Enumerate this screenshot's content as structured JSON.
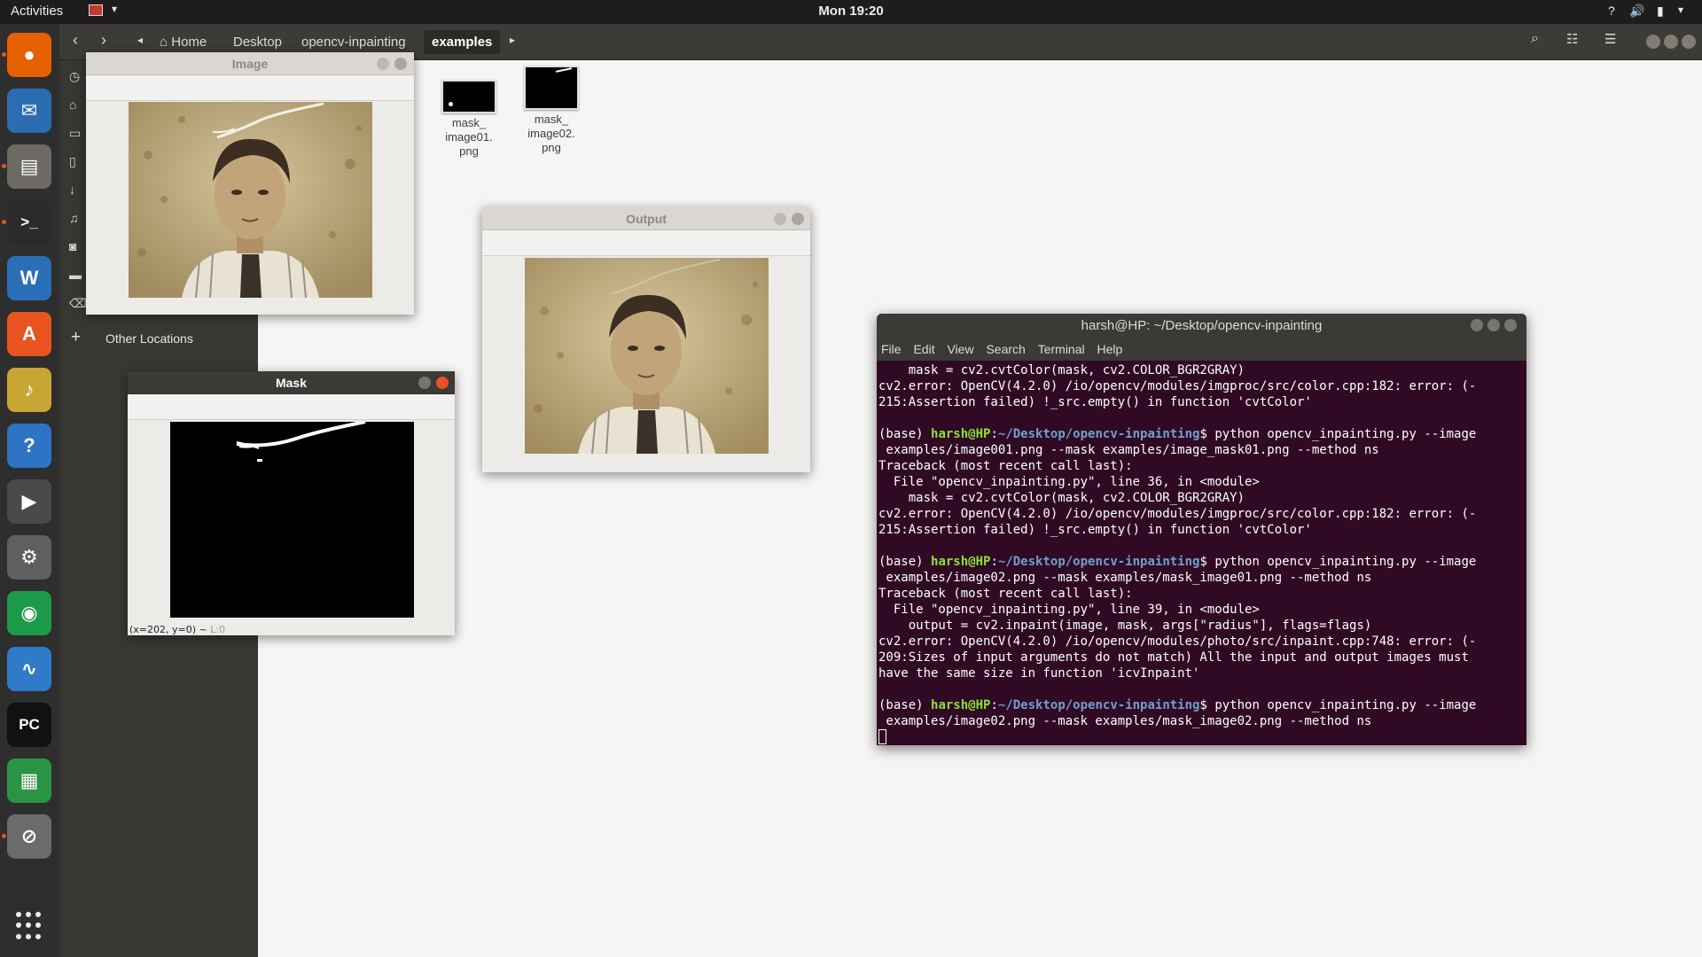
{
  "topbar": {
    "activities": "Activities",
    "clock": "Mon 19:20",
    "tray": {
      "help": "?",
      "volume": "🔊",
      "battery": "▮"
    }
  },
  "dock": {
    "items": [
      {
        "name": "firefox",
        "glyph": "●",
        "color": "#e66000",
        "running": true
      },
      {
        "name": "thunderbird",
        "glyph": "✉",
        "color": "#2b6cb0",
        "running": false
      },
      {
        "name": "files",
        "glyph": "▤",
        "color": "#6d6a63",
        "running": true
      },
      {
        "name": "terminal",
        "glyph": ">_",
        "color": "#2b2b2b",
        "running": true
      },
      {
        "name": "writer",
        "glyph": "W",
        "color": "#2a6fb8",
        "running": false
      },
      {
        "name": "software",
        "glyph": "A",
        "color": "#e95420",
        "running": false
      },
      {
        "name": "rhythmbox",
        "glyph": "♪",
        "color": "#c8a633",
        "running": false
      },
      {
        "name": "help",
        "glyph": "?",
        "color": "#2e74c4",
        "running": false
      },
      {
        "name": "videos",
        "glyph": "▶",
        "color": "#4a4a4a",
        "running": false
      },
      {
        "name": "settings",
        "glyph": "⚙",
        "color": "#5f5f5f",
        "running": false
      },
      {
        "name": "chrome",
        "glyph": "◉",
        "color": "#1b9a48",
        "running": false
      },
      {
        "name": "monitor",
        "glyph": "∿",
        "color": "#2f7ac9",
        "running": false
      },
      {
        "name": "pycharm",
        "glyph": "PC",
        "color": "#111111",
        "running": false
      },
      {
        "name": "calc",
        "glyph": "▦",
        "color": "#2b9444",
        "running": false
      },
      {
        "name": "blocked",
        "glyph": "⊘",
        "color": "#6b6b6b",
        "running": true
      }
    ]
  },
  "files": {
    "breadcrumbs": [
      "Home",
      "Desktop",
      "opencv-inpainting",
      "examples"
    ],
    "sidebar_other": "Other Locations",
    "items": [
      {
        "line1": "mask_",
        "line2": "image01.",
        "line3": "png"
      },
      {
        "line1": "mask_",
        "line2": "image02.",
        "line3": "png"
      }
    ]
  },
  "windows": {
    "image": {
      "title": "Image"
    },
    "output": {
      "title": "Output"
    },
    "mask": {
      "title": "Mask",
      "status": "(x=202, y=0) ~",
      "status_faded": "L:0"
    }
  },
  "terminal": {
    "title": "harsh@HP: ~/Desktop/opencv-inpainting",
    "menu": [
      "File",
      "Edit",
      "View",
      "Search",
      "Terminal",
      "Help"
    ],
    "user": "harsh@HP",
    "path": "~/Desktop/opencv-inpainting",
    "lines": [
      {
        "t": "    mask = cv2.cvtColor(mask, cv2.COLOR_BGR2GRAY)"
      },
      {
        "t": "cv2.error: OpenCV(4.2.0) /io/opencv/modules/imgproc/src/color.cpp:182: error: (-"
      },
      {
        "t": "215:Assertion failed) !_src.empty() in function 'cvtColor'"
      },
      {
        "t": ""
      },
      {
        "prompt": true,
        "cmd": " python opencv_inpainting.py --image"
      },
      {
        "t": " examples/image001.png --mask examples/image_mask01.png --method ns"
      },
      {
        "t": "Traceback (most recent call last):"
      },
      {
        "t": "  File \"opencv_inpainting.py\", line 36, in <module>"
      },
      {
        "t": "    mask = cv2.cvtColor(mask, cv2.COLOR_BGR2GRAY)"
      },
      {
        "t": "cv2.error: OpenCV(4.2.0) /io/opencv/modules/imgproc/src/color.cpp:182: error: (-"
      },
      {
        "t": "215:Assertion failed) !_src.empty() in function 'cvtColor'"
      },
      {
        "t": ""
      },
      {
        "prompt": true,
        "cmd": " python opencv_inpainting.py --image"
      },
      {
        "t": " examples/image02.png --mask examples/mask_image01.png --method ns"
      },
      {
        "t": "Traceback (most recent call last):"
      },
      {
        "t": "  File \"opencv_inpainting.py\", line 39, in <module>"
      },
      {
        "t": "    output = cv2.inpaint(image, mask, args[\"radius\"], flags=flags)"
      },
      {
        "t": "cv2.error: OpenCV(4.2.0) /io/opencv/modules/photo/src/inpaint.cpp:748: error: (-"
      },
      {
        "t": "209:Sizes of input arguments do not match) All the input and output images must"
      },
      {
        "t": "have the same size in function 'icvInpaint'"
      },
      {
        "t": ""
      },
      {
        "prompt": true,
        "cmd": " python opencv_inpainting.py --image"
      },
      {
        "t": " examples/image02.png --mask examples/mask_image02.png --method ns"
      }
    ]
  }
}
